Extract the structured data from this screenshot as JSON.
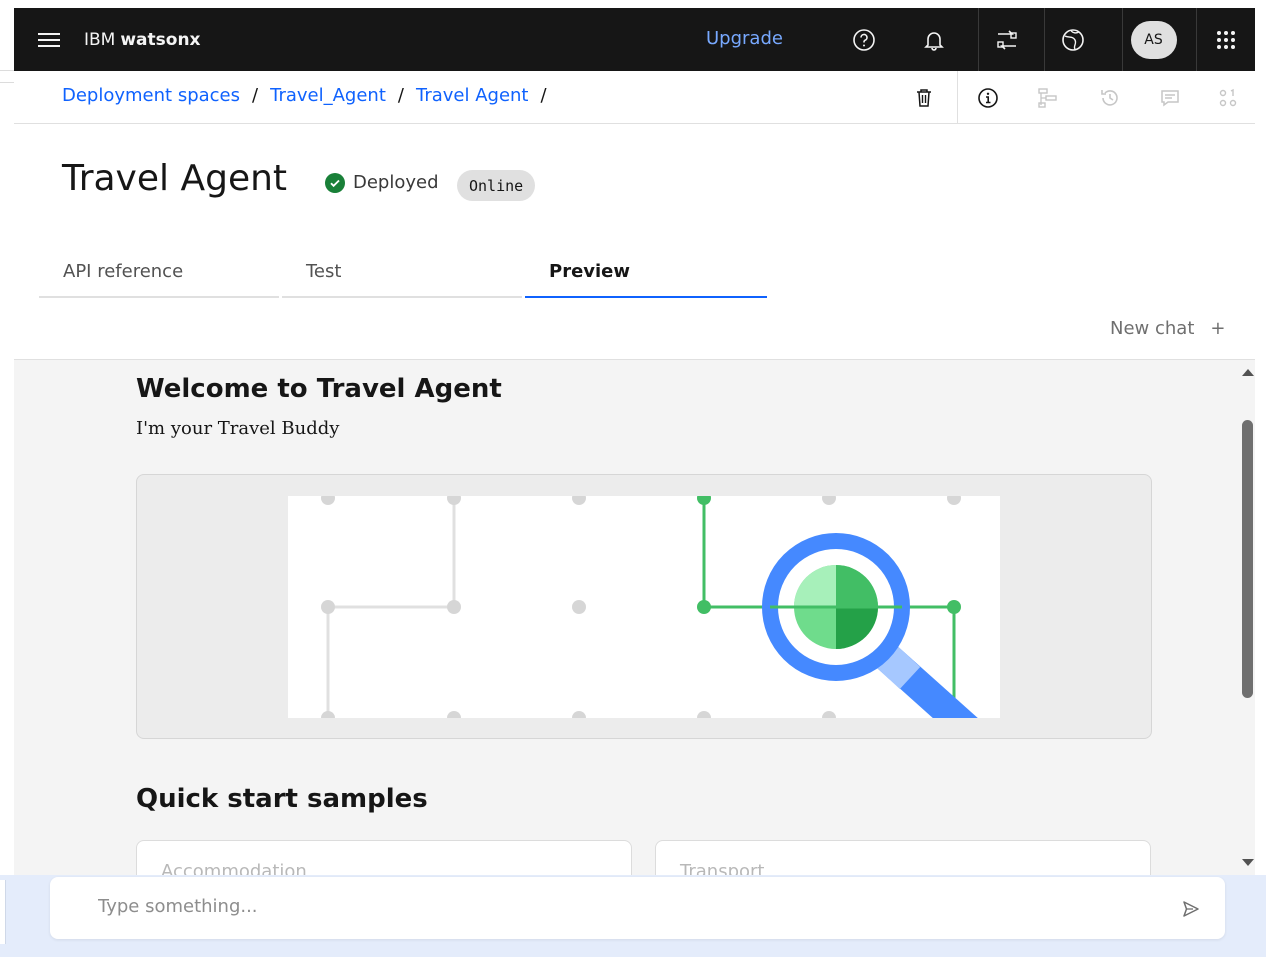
{
  "topbar": {
    "brand_prefix": "IBM",
    "brand_product": "watsonx",
    "upgrade_label": "Upgrade",
    "avatar_initials": "AS",
    "icons": [
      "menu-icon",
      "help-icon",
      "notification-icon",
      "switcher-icon",
      "global-icon",
      "app-grid-icon"
    ]
  },
  "breadcrumb": {
    "items": [
      "Deployment spaces",
      "Travel_Agent",
      "Travel Agent"
    ],
    "separator": "/"
  },
  "toolbar_icons": [
    "delete-icon",
    "info-icon",
    "lineage-icon",
    "history-icon",
    "comments-icon",
    "data-icon"
  ],
  "page": {
    "title": "Travel Agent",
    "status": "Deployed",
    "status_color": "#198038",
    "tag": "Online"
  },
  "tabs": [
    {
      "label": "API reference",
      "active": false
    },
    {
      "label": "Test",
      "active": false
    },
    {
      "label": "Preview",
      "active": true
    }
  ],
  "chat": {
    "new_chat_label": "New chat",
    "new_chat_icon": "+",
    "welcome_title": "Welcome to Travel Agent",
    "welcome_subtitle": "I'm your Travel Buddy",
    "quick_start_title": "Quick start samples",
    "quick_start_items": [
      "Accommodation",
      "Transport"
    ],
    "input_placeholder": "Type something..."
  },
  "colors": {
    "accent": "#0f62fe",
    "topbar_bg": "#161616",
    "upgrade_link": "#78a9ff",
    "illustration_green": "#42be65",
    "illustration_blue": "#4589ff"
  }
}
